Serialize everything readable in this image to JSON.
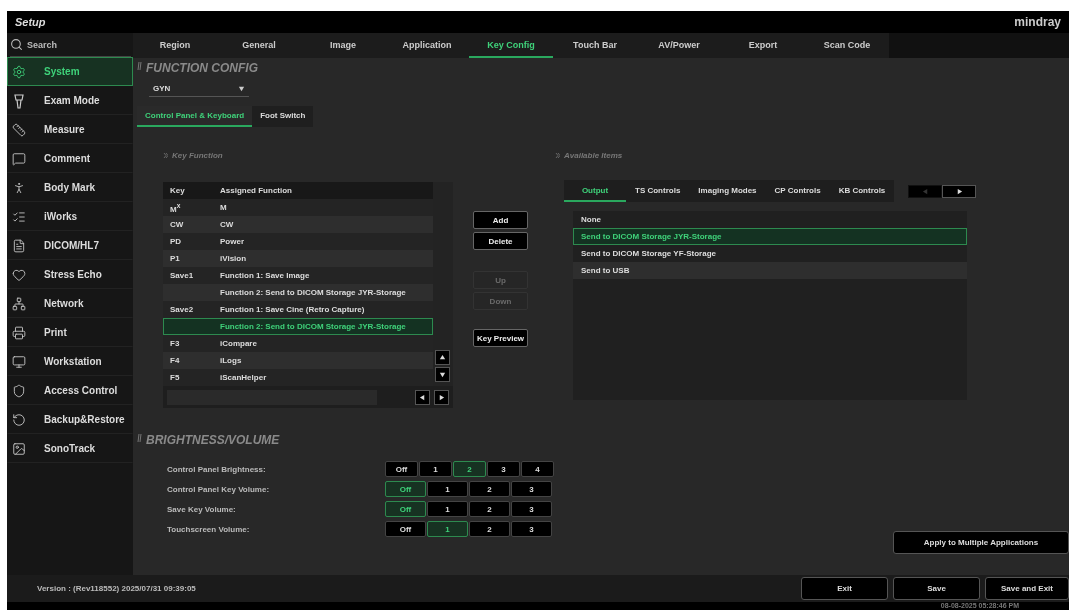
{
  "window": {
    "title": "Setup",
    "brand": "mindray"
  },
  "search": {
    "placeholder": "Search"
  },
  "sidebar": {
    "items": [
      {
        "label": "System",
        "selected": true
      },
      {
        "label": "Exam Mode",
        "selected": false
      },
      {
        "label": "Measure",
        "selected": false
      },
      {
        "label": "Comment",
        "selected": false
      },
      {
        "label": "Body Mark",
        "selected": false
      },
      {
        "label": "iWorks",
        "selected": false
      },
      {
        "label": "DICOM/HL7",
        "selected": false
      },
      {
        "label": "Stress Echo",
        "selected": false
      },
      {
        "label": "Network",
        "selected": false
      },
      {
        "label": "Print",
        "selected": false
      },
      {
        "label": "Workstation",
        "selected": false
      },
      {
        "label": "Access Control",
        "selected": false
      },
      {
        "label": "Backup&Restore",
        "selected": false
      },
      {
        "label": "SonoTrack",
        "selected": false
      }
    ]
  },
  "tabs": [
    {
      "label": "Region",
      "selected": false
    },
    {
      "label": "General",
      "selected": false
    },
    {
      "label": "Image",
      "selected": false
    },
    {
      "label": "Application",
      "selected": false
    },
    {
      "label": "Key Config",
      "selected": true
    },
    {
      "label": "Touch Bar",
      "selected": false
    },
    {
      "label": "AV/Power",
      "selected": false
    },
    {
      "label": "Export",
      "selected": false
    },
    {
      "label": "Scan Code",
      "selected": false
    }
  ],
  "function_config": {
    "title": "FUNCTION CONFIG",
    "application": "GYN",
    "subtabs": [
      {
        "label": "Control Panel & Keyboard",
        "selected": true
      },
      {
        "label": "Foot Switch",
        "selected": false
      }
    ],
    "key_function": {
      "title": "Key Function",
      "columns": [
        "Key",
        "Assigned Function"
      ],
      "rows": [
        {
          "key": "M$^{x}$",
          "function": "M",
          "selected": false
        },
        {
          "key": "CW",
          "function": "CW",
          "selected": false
        },
        {
          "key": "PD",
          "function": "Power",
          "selected": false
        },
        {
          "key": "P1",
          "function": "iVision",
          "selected": false
        },
        {
          "key": "Save1",
          "function": "Function 1: Save Image",
          "selected": false
        },
        {
          "key": "",
          "function": "Function 2: Send to DICOM Storage JYR-Storage",
          "selected": false
        },
        {
          "key": "Save2",
          "function": "Function 1: Save Cine (Retro Capture)",
          "selected": false
        },
        {
          "key": "",
          "function": "Function 2: Send to DICOM Storage JYR-Storage",
          "selected": true
        },
        {
          "key": "F3",
          "function": "iCompare",
          "selected": false
        },
        {
          "key": "F4",
          "function": "iLogs",
          "selected": false
        },
        {
          "key": "F5",
          "function": "iScanHelper",
          "selected": false
        }
      ]
    },
    "actions": [
      {
        "label": "Add",
        "disabled": false
      },
      {
        "label": "Delete",
        "disabled": false
      },
      {
        "label": "Up",
        "disabled": true
      },
      {
        "label": "Down",
        "disabled": true
      },
      {
        "label": "Key Preview",
        "disabled": false
      }
    ],
    "available_items": {
      "title": "Available Items",
      "tabs": [
        {
          "label": "Output",
          "selected": true
        },
        {
          "label": "TS Controls",
          "selected": false
        },
        {
          "label": "Imaging Modes",
          "selected": false
        },
        {
          "label": "CP Controls",
          "selected": false
        },
        {
          "label": "KB Controls",
          "selected": false
        }
      ],
      "pager": [
        {
          "disabled": true
        },
        {
          "disabled": false
        }
      ],
      "items": [
        {
          "label": "None",
          "selected": false
        },
        {
          "label": "Send to DICOM Storage JYR-Storage",
          "selected": true
        },
        {
          "label": "Send to DICOM Storage YF-Storage",
          "selected": false
        },
        {
          "label": "Send to USB",
          "selected": false
        }
      ]
    }
  },
  "brightness_volume": {
    "title": "BRIGHTNESS/VOLUME",
    "settings": [
      {
        "label": "Control Panel Brightness:",
        "options": [
          {
            "label": "Off",
            "selected": false
          },
          {
            "label": "1",
            "selected": false
          },
          {
            "label": "2",
            "selected": true
          },
          {
            "label": "3",
            "selected": false
          },
          {
            "label": "4",
            "selected": false
          }
        ]
      },
      {
        "label": "Control Panel Key Volume:",
        "options": [
          {
            "label": "Off",
            "selected": true
          },
          {
            "label": "1",
            "selected": false
          },
          {
            "label": "2",
            "selected": false
          },
          {
            "label": "3",
            "selected": false
          }
        ]
      },
      {
        "label": "Save Key Volume:",
        "options": [
          {
            "label": "Off",
            "selected": true
          },
          {
            "label": "1",
            "selected": false
          },
          {
            "label": "2",
            "selected": false
          },
          {
            "label": "3",
            "selected": false
          }
        ]
      },
      {
        "label": "Touchscreen Volume:",
        "options": [
          {
            "label": "Off",
            "selected": false
          },
          {
            "label": "1",
            "selected": true
          },
          {
            "label": "2",
            "selected": false
          },
          {
            "label": "3",
            "selected": false
          }
        ]
      }
    ],
    "apply_button": "Apply to Multiple Applications"
  },
  "status_bar": {
    "version": "Version : (Rev118552) 2025/07/31 09:39:05",
    "datetime": "08-08-2025  05:28:46 PM"
  },
  "footer_buttons": [
    "Exit",
    "Save",
    "Save and Exit"
  ]
}
